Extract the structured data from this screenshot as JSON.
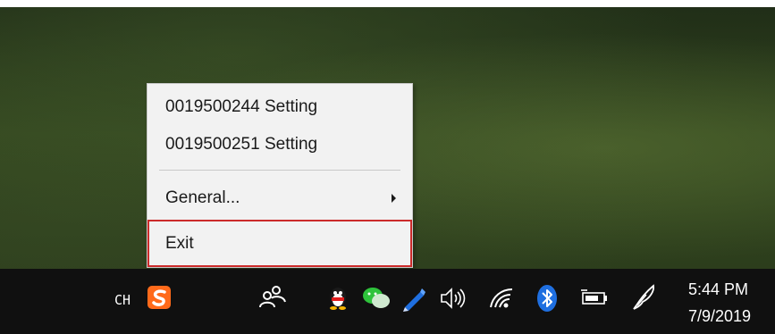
{
  "context_menu": {
    "items": [
      {
        "label": "0019500244 Setting"
      },
      {
        "label": "0019500251 Setting"
      },
      {
        "label": "General..."
      },
      {
        "label": "Exit"
      }
    ]
  },
  "taskbar": {
    "input_method_label": "CH",
    "clock": {
      "time": "5:44 PM",
      "date": "7/9/2019"
    },
    "tray_icons": [
      "sogou-input-icon",
      "people-icon",
      "qq-penguin-icon",
      "wechat-icon",
      "pen-icon",
      "volume-icon",
      "wifi-icon",
      "bluetooth-icon",
      "battery-icon",
      "feather-pen-icon"
    ]
  },
  "colors": {
    "taskbar_bg": "#101010",
    "menu_bg": "#f2f2f2",
    "exit_highlight_border": "#cc2b2b",
    "bluetooth_blue": "#1f6fe0",
    "sogou_orange": "#ff6a1a",
    "wechat_green": "#2ec33b"
  }
}
